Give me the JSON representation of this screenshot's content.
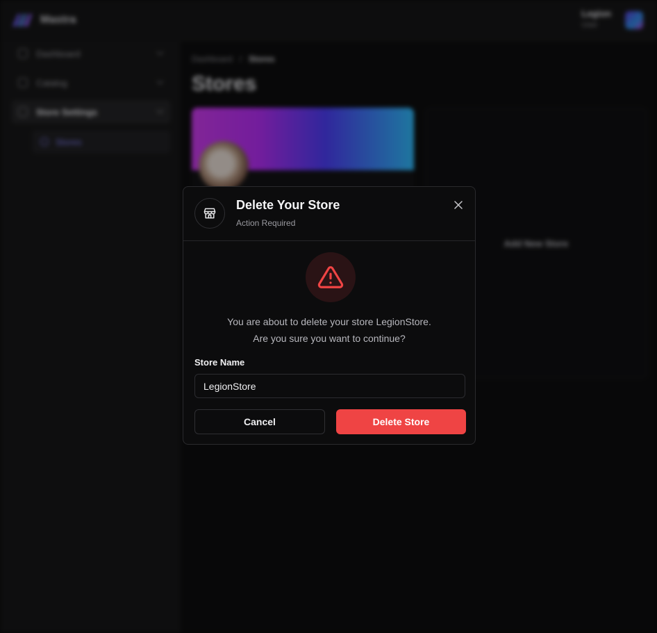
{
  "app": {
    "brand": "Mastra",
    "user": {
      "name": "Legion",
      "role": "User"
    }
  },
  "sidebar": {
    "items": [
      {
        "label": "Dashboard"
      },
      {
        "label": "Catalog"
      },
      {
        "label": "Store Settings"
      }
    ],
    "subitems": [
      {
        "label": "Stores"
      }
    ]
  },
  "main": {
    "breadcrumb": [
      "Dashboard",
      "/",
      "Stores"
    ],
    "title": "Stores",
    "add_store_label": "Add New Store"
  },
  "modal": {
    "title": "Delete Your Store",
    "subtitle": "Action Required",
    "message_line1": "You are about to delete your store LegionStore.",
    "message_line2": "Are you sure you want to continue?",
    "field_label": "Store Name",
    "field_value": "LegionStore",
    "cancel_label": "Cancel",
    "delete_label": "Delete Store"
  },
  "colors": {
    "danger": "#ef4444",
    "accent": "#7f7cf0",
    "modal_bg": "#0c0c0d"
  },
  "icons": {
    "header_icon": "store-icon",
    "warning": "alert-triangle-icon",
    "close": "close-icon"
  }
}
